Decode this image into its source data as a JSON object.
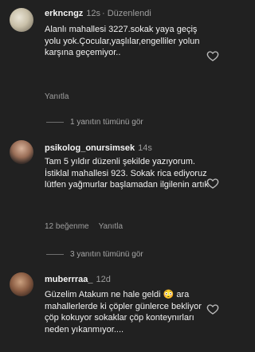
{
  "comments": [
    {
      "username": "erkncngz",
      "time": "12s",
      "edited": "Düzenlendi",
      "text": "Alanlı mahallesi 3227.sokak yaya geçiş yolu yok.Çocular,yaşlılar,engelliler yolun karşına geçemiyor..",
      "likes": "",
      "reply_label": "Yanıtla",
      "view_replies": "1 yanıtın tümünü gör"
    },
    {
      "username": "psikolog_onursimsek",
      "time": "14s",
      "text": "Tam 5 yıldır düzenli şekilde yazıyorum. İstiklal mahallesi 923. Sokak rica ediyoruz lütfen yağmurlar başlamadan ilgilenin artık",
      "likes": "12 beğenme",
      "reply_label": "Yanıtla",
      "view_replies": "3 yanıtın tümünü gör"
    },
    {
      "username": "muberrraa_",
      "time": "12d",
      "text": "Güzelim Atakum ne hale geldi 😳 ara mahallerlerde ki çöpler günlerce bekliyor çöp kokuyor sokaklar çöp konteynırları neden yıkanmıyor....",
      "likes": ""
    }
  ]
}
